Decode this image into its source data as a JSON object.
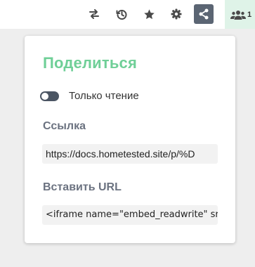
{
  "toolbar": {
    "buttons": [
      {
        "name": "swap",
        "icon": "swap-arrows-icon"
      },
      {
        "name": "history",
        "icon": "history-icon"
      },
      {
        "name": "favorite",
        "icon": "star-icon"
      },
      {
        "name": "settings",
        "icon": "gear-icon"
      },
      {
        "name": "share",
        "icon": "share-icon",
        "active": true
      }
    ],
    "users": {
      "icon": "users-icon",
      "count": "1"
    }
  },
  "share_popup": {
    "title": "Поделиться",
    "read_only_toggle": {
      "label": "Только чтение",
      "checked": false
    },
    "link": {
      "label": "Ссылка",
      "value": "https://docs.hometested.site/p/%D"
    },
    "embed": {
      "label": "Вставить URL",
      "value": "<iframe name=\"embed_readwrite\" src=\"https://docs.hometested.site/p/"
    }
  },
  "colors": {
    "accent": "#6fcf97",
    "active_button": "#5b6573",
    "users_bg": "#dff3e8",
    "field_bg": "#f2f2f2"
  }
}
